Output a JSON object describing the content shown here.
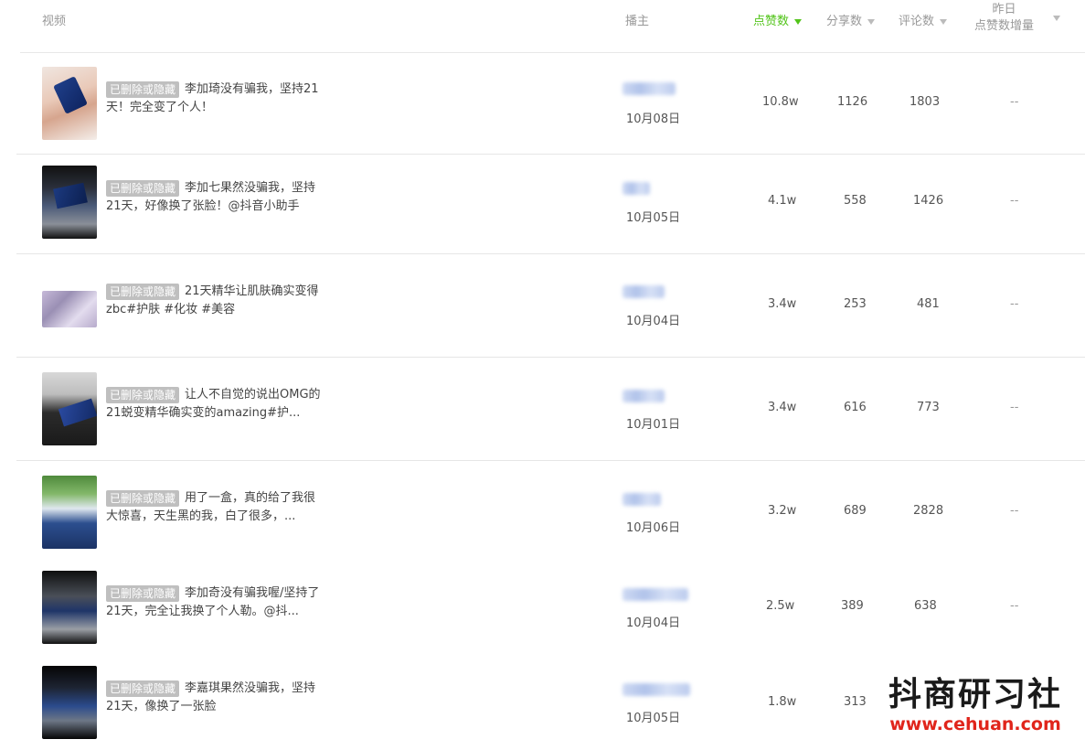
{
  "header": {
    "video": "视频",
    "streamer": "播主",
    "likes": "点赞数",
    "shares": "分享数",
    "comments": "评论数",
    "growth_line1": "昨日",
    "growth_line2": "点赞数增量"
  },
  "sorted_color": "#52c41a",
  "rows": [
    {
      "badge": "已删除或隐藏",
      "title": "李加琦没有骗我，坚持21天！完全变了个人！",
      "date": "10月08日",
      "likes": "10.8w",
      "shares": "1126",
      "comments": "1803",
      "growth": "--"
    },
    {
      "badge": "已删除或隐藏",
      "title": "李加七果然没骗我，坚持21天，好像换了张脸！@抖音小助手",
      "date": "10月05日",
      "likes": "4.1w",
      "shares": "558",
      "comments": "1426",
      "growth": "--"
    },
    {
      "badge": "已删除或隐藏",
      "title": "21天精华让肌肤确实变得zbc#护肤 #化妆 #美容",
      "date": "10月04日",
      "likes": "3.4w",
      "shares": "253",
      "comments": "481",
      "growth": "--"
    },
    {
      "badge": "已删除或隐藏",
      "title": "让人不自觉的说出OMG的21蜕变精华确实变的amazing#护...",
      "date": "10月01日",
      "likes": "3.4w",
      "shares": "616",
      "comments": "773",
      "growth": "--"
    },
    {
      "badge": "已删除或隐藏",
      "title": "用了一盒，真的给了我很大惊喜，天生黑的我，白了很多，...",
      "date": "10月06日",
      "likes": "3.2w",
      "shares": "689",
      "comments": "2828",
      "growth": "--"
    },
    {
      "badge": "已删除或隐藏",
      "title": "李加奇没有骗我喔/坚持了21天，完全让我换了个人勒。@抖...",
      "date": "10月04日",
      "likes": "2.5w",
      "shares": "389",
      "comments": "638",
      "growth": "--"
    },
    {
      "badge": "已删除或隐藏",
      "title": "李嘉琪果然没骗我，坚持21天，像换了一张脸",
      "date": "10月05日",
      "likes": "1.8w",
      "shares": "313",
      "comments": "",
      "growth": ""
    }
  ],
  "watermark": {
    "title": "抖商研习社",
    "url": "www.cehuan.com"
  }
}
